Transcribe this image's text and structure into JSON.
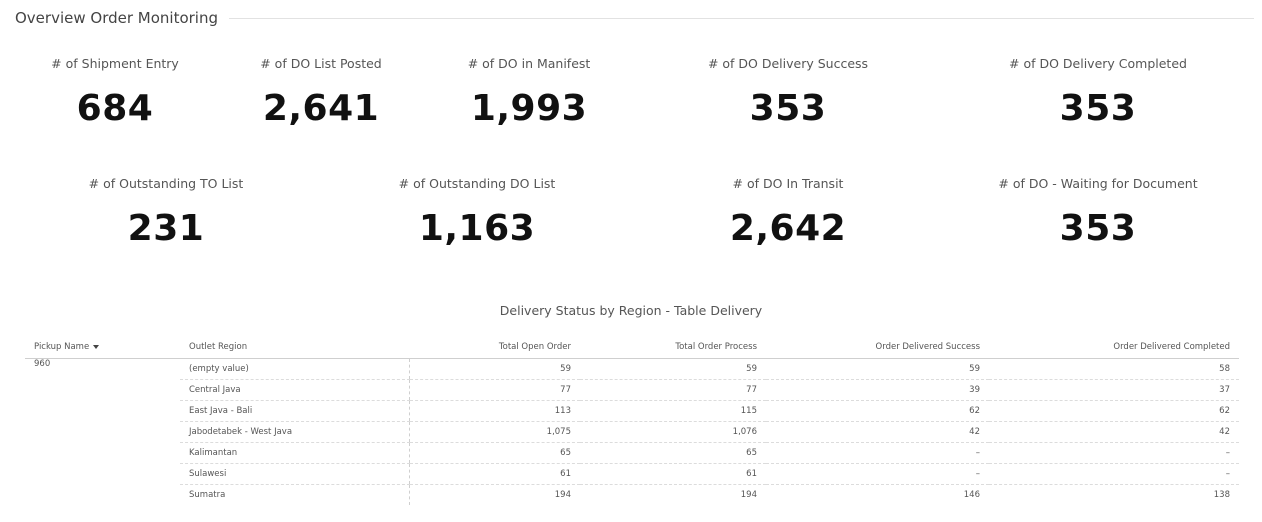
{
  "header": {
    "title": "Overview Order Monitoring"
  },
  "kpis_row1": [
    {
      "label": "# of Shipment Entry",
      "value": "684"
    },
    {
      "label": "# of DO List Posted",
      "value": "2,641"
    },
    {
      "label": "# of DO in Manifest",
      "value": "1,993"
    },
    {
      "label": "# of DO Delivery Success",
      "value": "353"
    },
    {
      "label": "# of DO Delivery Completed",
      "value": "353"
    }
  ],
  "kpis_row2": [
    {
      "label": "# of Outstanding TO List",
      "value": "231"
    },
    {
      "label": "# of Outstanding DO List",
      "value": "1,163"
    },
    {
      "label": "# of DO In Transit",
      "value": "2,642"
    },
    {
      "label": "# of DO - Waiting for Document",
      "value": "353"
    }
  ],
  "table": {
    "title": "Delivery Status by Region - Table Delivery",
    "columns": [
      "Pickup Name",
      "Outlet Region",
      "Total Open Order",
      "Total Order Process",
      "Order Delivered Success",
      "Order Delivered Completed"
    ],
    "pickup": "960",
    "rows": [
      {
        "region": "(empty value)",
        "open": "59",
        "process": "59",
        "success": "59",
        "completed": "58"
      },
      {
        "region": "Central Java",
        "open": "77",
        "process": "77",
        "success": "39",
        "completed": "37"
      },
      {
        "region": "East Java - Bali",
        "open": "113",
        "process": "115",
        "success": "62",
        "completed": "62"
      },
      {
        "region": "Jabodetabek - West Java",
        "open": "1,075",
        "process": "1,076",
        "success": "42",
        "completed": "42"
      },
      {
        "region": "Kalimantan",
        "open": "65",
        "process": "65",
        "success": "–",
        "completed": "–"
      },
      {
        "region": "Sulawesi",
        "open": "61",
        "process": "61",
        "success": "–",
        "completed": "–"
      },
      {
        "region": "Sumatra",
        "open": "194",
        "process": "194",
        "success": "146",
        "completed": "138"
      }
    ]
  }
}
